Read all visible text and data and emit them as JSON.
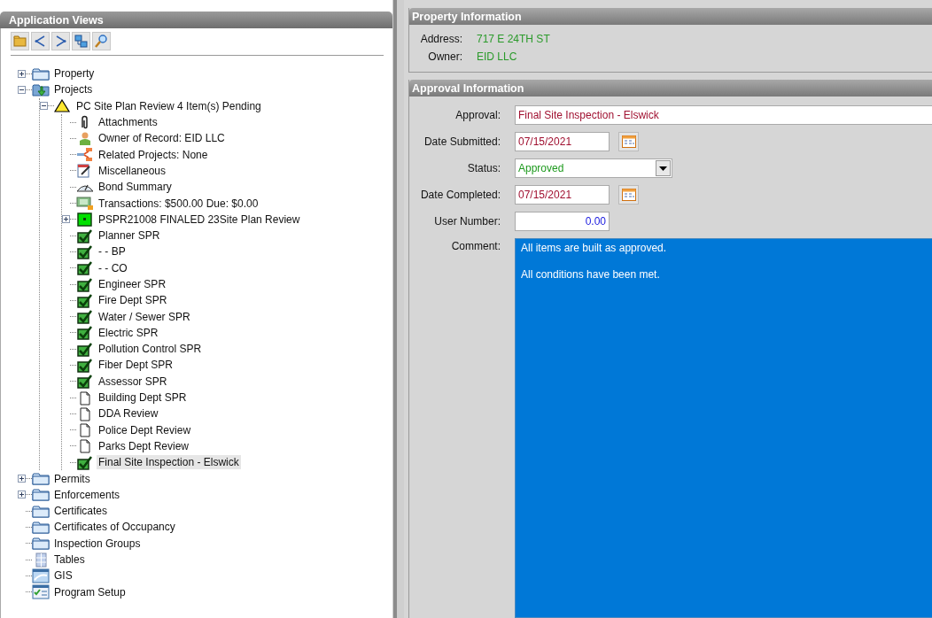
{
  "panel": {
    "title": "Application Views"
  },
  "tree": [
    {
      "label": "Property",
      "kind": "folder",
      "expanded": false,
      "selected": false
    },
    {
      "label": "Projects",
      "kind": "projects",
      "expanded": true,
      "selected": false,
      "children": [
        {
          "label": "PC Site Plan Review 4 Item(s) Pending",
          "kind": "warning",
          "expanded": true,
          "selected": false,
          "children": [
            {
              "label": "Attachments",
              "kind": "clip",
              "selected": false
            },
            {
              "label": "Owner of Record: EID LLC",
              "kind": "person",
              "selected": false
            },
            {
              "label": "Related Projects: None",
              "kind": "related",
              "selected": false
            },
            {
              "label": "Miscellaneous",
              "kind": "notes",
              "selected": false
            },
            {
              "label": "Bond Summary",
              "kind": "bond",
              "selected": false
            },
            {
              "label": "Transactions: $500.00 Due: $0.00",
              "kind": "money",
              "selected": false
            },
            {
              "label": "PSPR21008 FINALED 23Site Plan Review",
              "kind": "status",
              "expanded": false,
              "selected": false
            },
            {
              "label": "Planner SPR",
              "kind": "done",
              "selected": false
            },
            {
              "label": " - - BP",
              "kind": "done",
              "selected": false
            },
            {
              "label": " - - CO",
              "kind": "done",
              "selected": false
            },
            {
              "label": "Engineer SPR",
              "kind": "done",
              "selected": false
            },
            {
              "label": "Fire Dept SPR",
              "kind": "done",
              "selected": false
            },
            {
              "label": "Water / Sewer SPR",
              "kind": "done",
              "selected": false
            },
            {
              "label": "Electric SPR",
              "kind": "done",
              "selected": false
            },
            {
              "label": "Pollution Control SPR",
              "kind": "done",
              "selected": false
            },
            {
              "label": "Fiber Dept SPR",
              "kind": "done",
              "selected": false
            },
            {
              "label": "Assessor SPR",
              "kind": "done",
              "selected": false
            },
            {
              "label": "Building Dept SPR",
              "kind": "doc",
              "selected": false
            },
            {
              "label": "DDA Review",
              "kind": "doc",
              "selected": false
            },
            {
              "label": "Police Dept Review",
              "kind": "doc",
              "selected": false
            },
            {
              "label": "Parks Dept Review",
              "kind": "doc",
              "selected": false
            },
            {
              "label": "Final Site Inspection - Elswick",
              "kind": "done",
              "selected": true
            }
          ]
        }
      ]
    },
    {
      "label": "Permits",
      "kind": "folder",
      "expanded": false,
      "selected": false
    },
    {
      "label": "Enforcements",
      "kind": "folder",
      "expanded": false,
      "selected": false
    },
    {
      "label": "Certificates",
      "kind": "folder",
      "selected": false
    },
    {
      "label": "Certificates of Occupancy",
      "kind": "folder",
      "selected": false
    },
    {
      "label": "Inspection Groups",
      "kind": "folder",
      "selected": false
    },
    {
      "label": "Tables",
      "kind": "table",
      "selected": false
    },
    {
      "label": "GIS",
      "kind": "gis",
      "selected": false
    },
    {
      "label": "Program Setup",
      "kind": "setup",
      "selected": false
    }
  ],
  "property": {
    "title": "Property Information",
    "fields": [
      {
        "label": "Address:",
        "value": "717 E 24TH ST"
      },
      {
        "label": "Owner:",
        "value": "EID LLC"
      }
    ]
  },
  "approval": {
    "title": "Approval Information",
    "fields": [
      {
        "kind": "text",
        "label": "Approval:",
        "value": "Final Site Inspection - Elswick"
      },
      {
        "kind": "date",
        "label": "Date Submitted:",
        "value": "07/15/2021"
      },
      {
        "kind": "select",
        "label": "Status:",
        "value": "Approved"
      },
      {
        "kind": "date",
        "label": "Date Completed:",
        "value": "07/15/2021"
      },
      {
        "kind": "number",
        "label": "User Number:",
        "value": "0.00"
      },
      {
        "kind": "memo",
        "label": "Comment:",
        "lines": [
          "All items are built as approved.",
          "All conditions have been met."
        ]
      }
    ]
  }
}
